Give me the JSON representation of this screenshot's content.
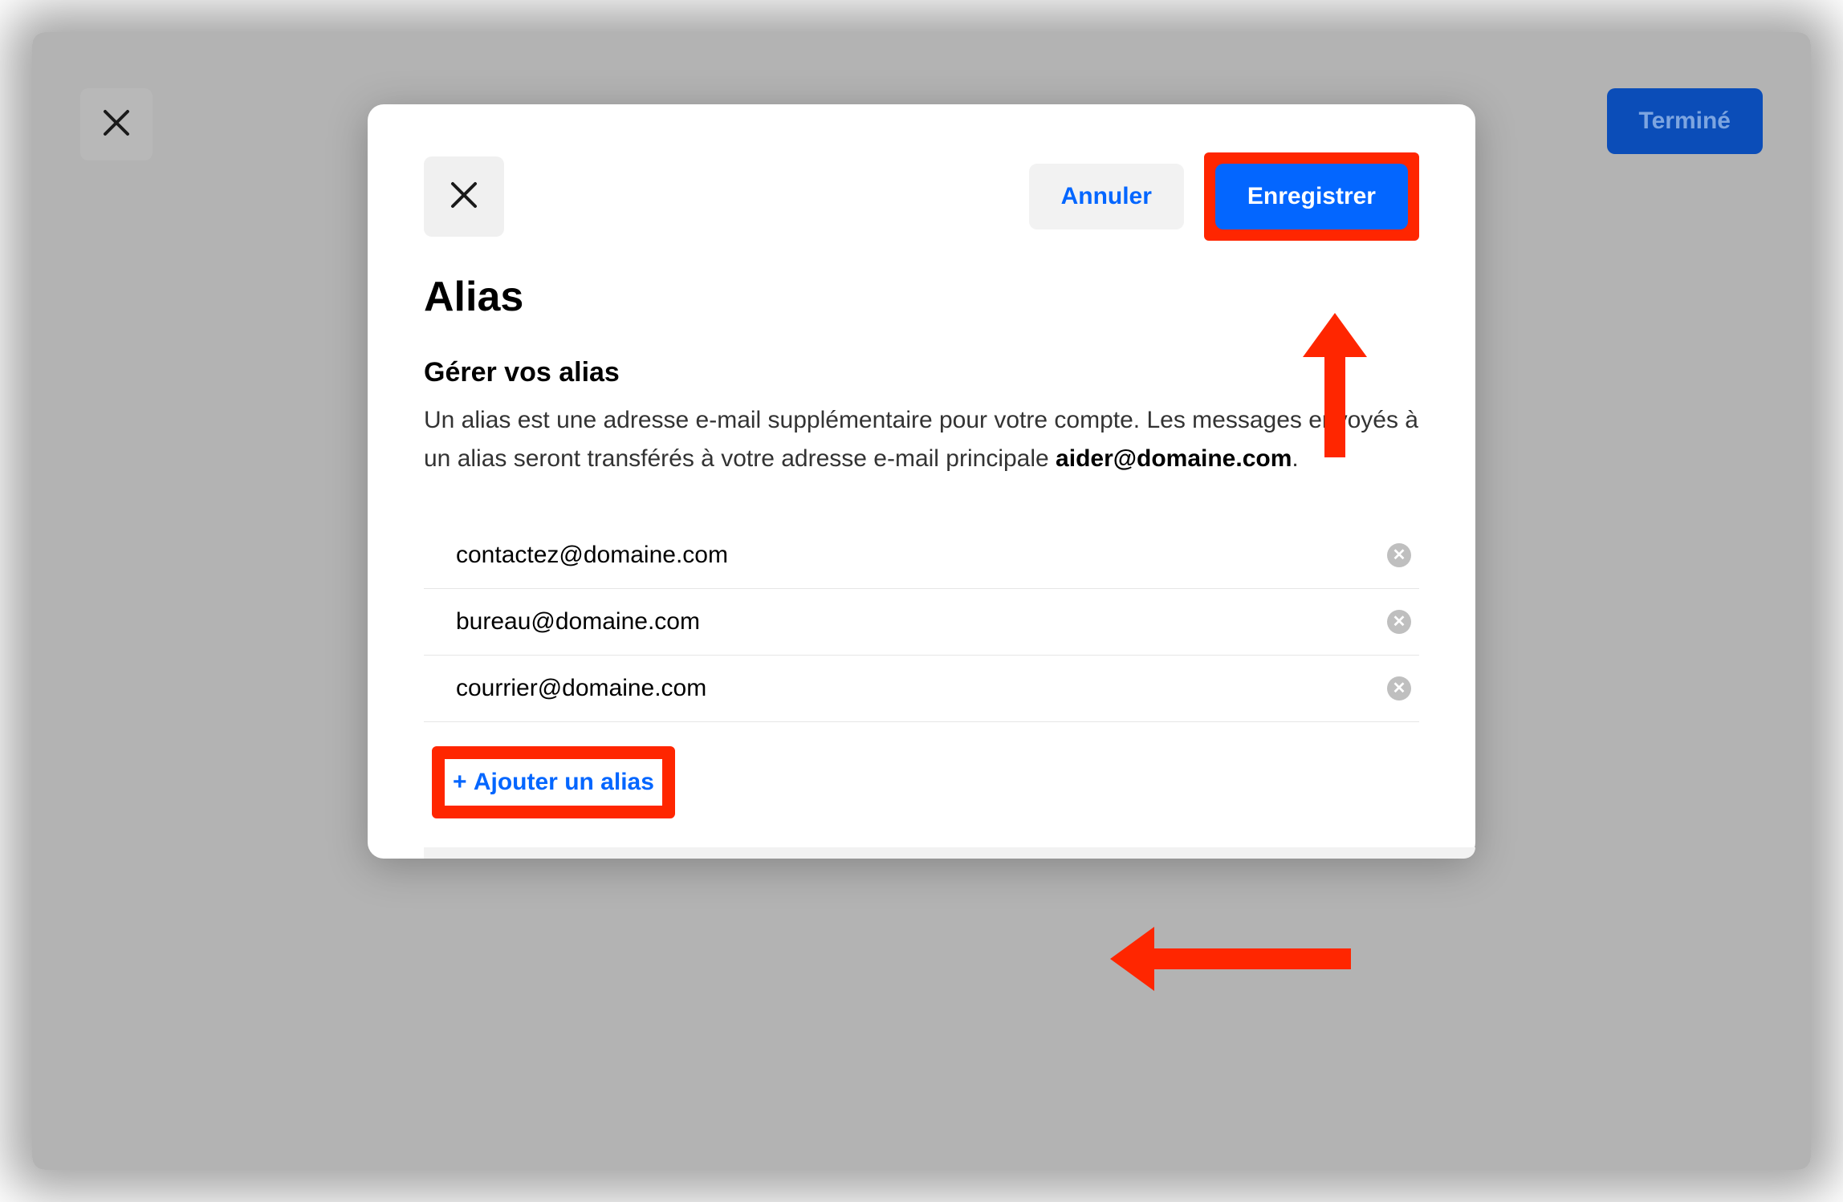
{
  "outer": {
    "done_label": "Terminé"
  },
  "modal": {
    "cancel_label": "Annuler",
    "save_label": "Enregistrer",
    "title": "Alias",
    "section_title": "Gérer vos alias",
    "description_part1": "Un alias est une adresse e-mail supplémentaire pour votre compte. Les messages envoyés à un alias seront transférés à votre adresse e-mail principale ",
    "description_email": "aider@domaine.com",
    "description_period": ".",
    "add_label": "Ajouter un alias",
    "aliases": [
      {
        "email": "contactez@domaine.com"
      },
      {
        "email": "bureau@domaine.com"
      },
      {
        "email": "courrier@domaine.com"
      }
    ]
  }
}
